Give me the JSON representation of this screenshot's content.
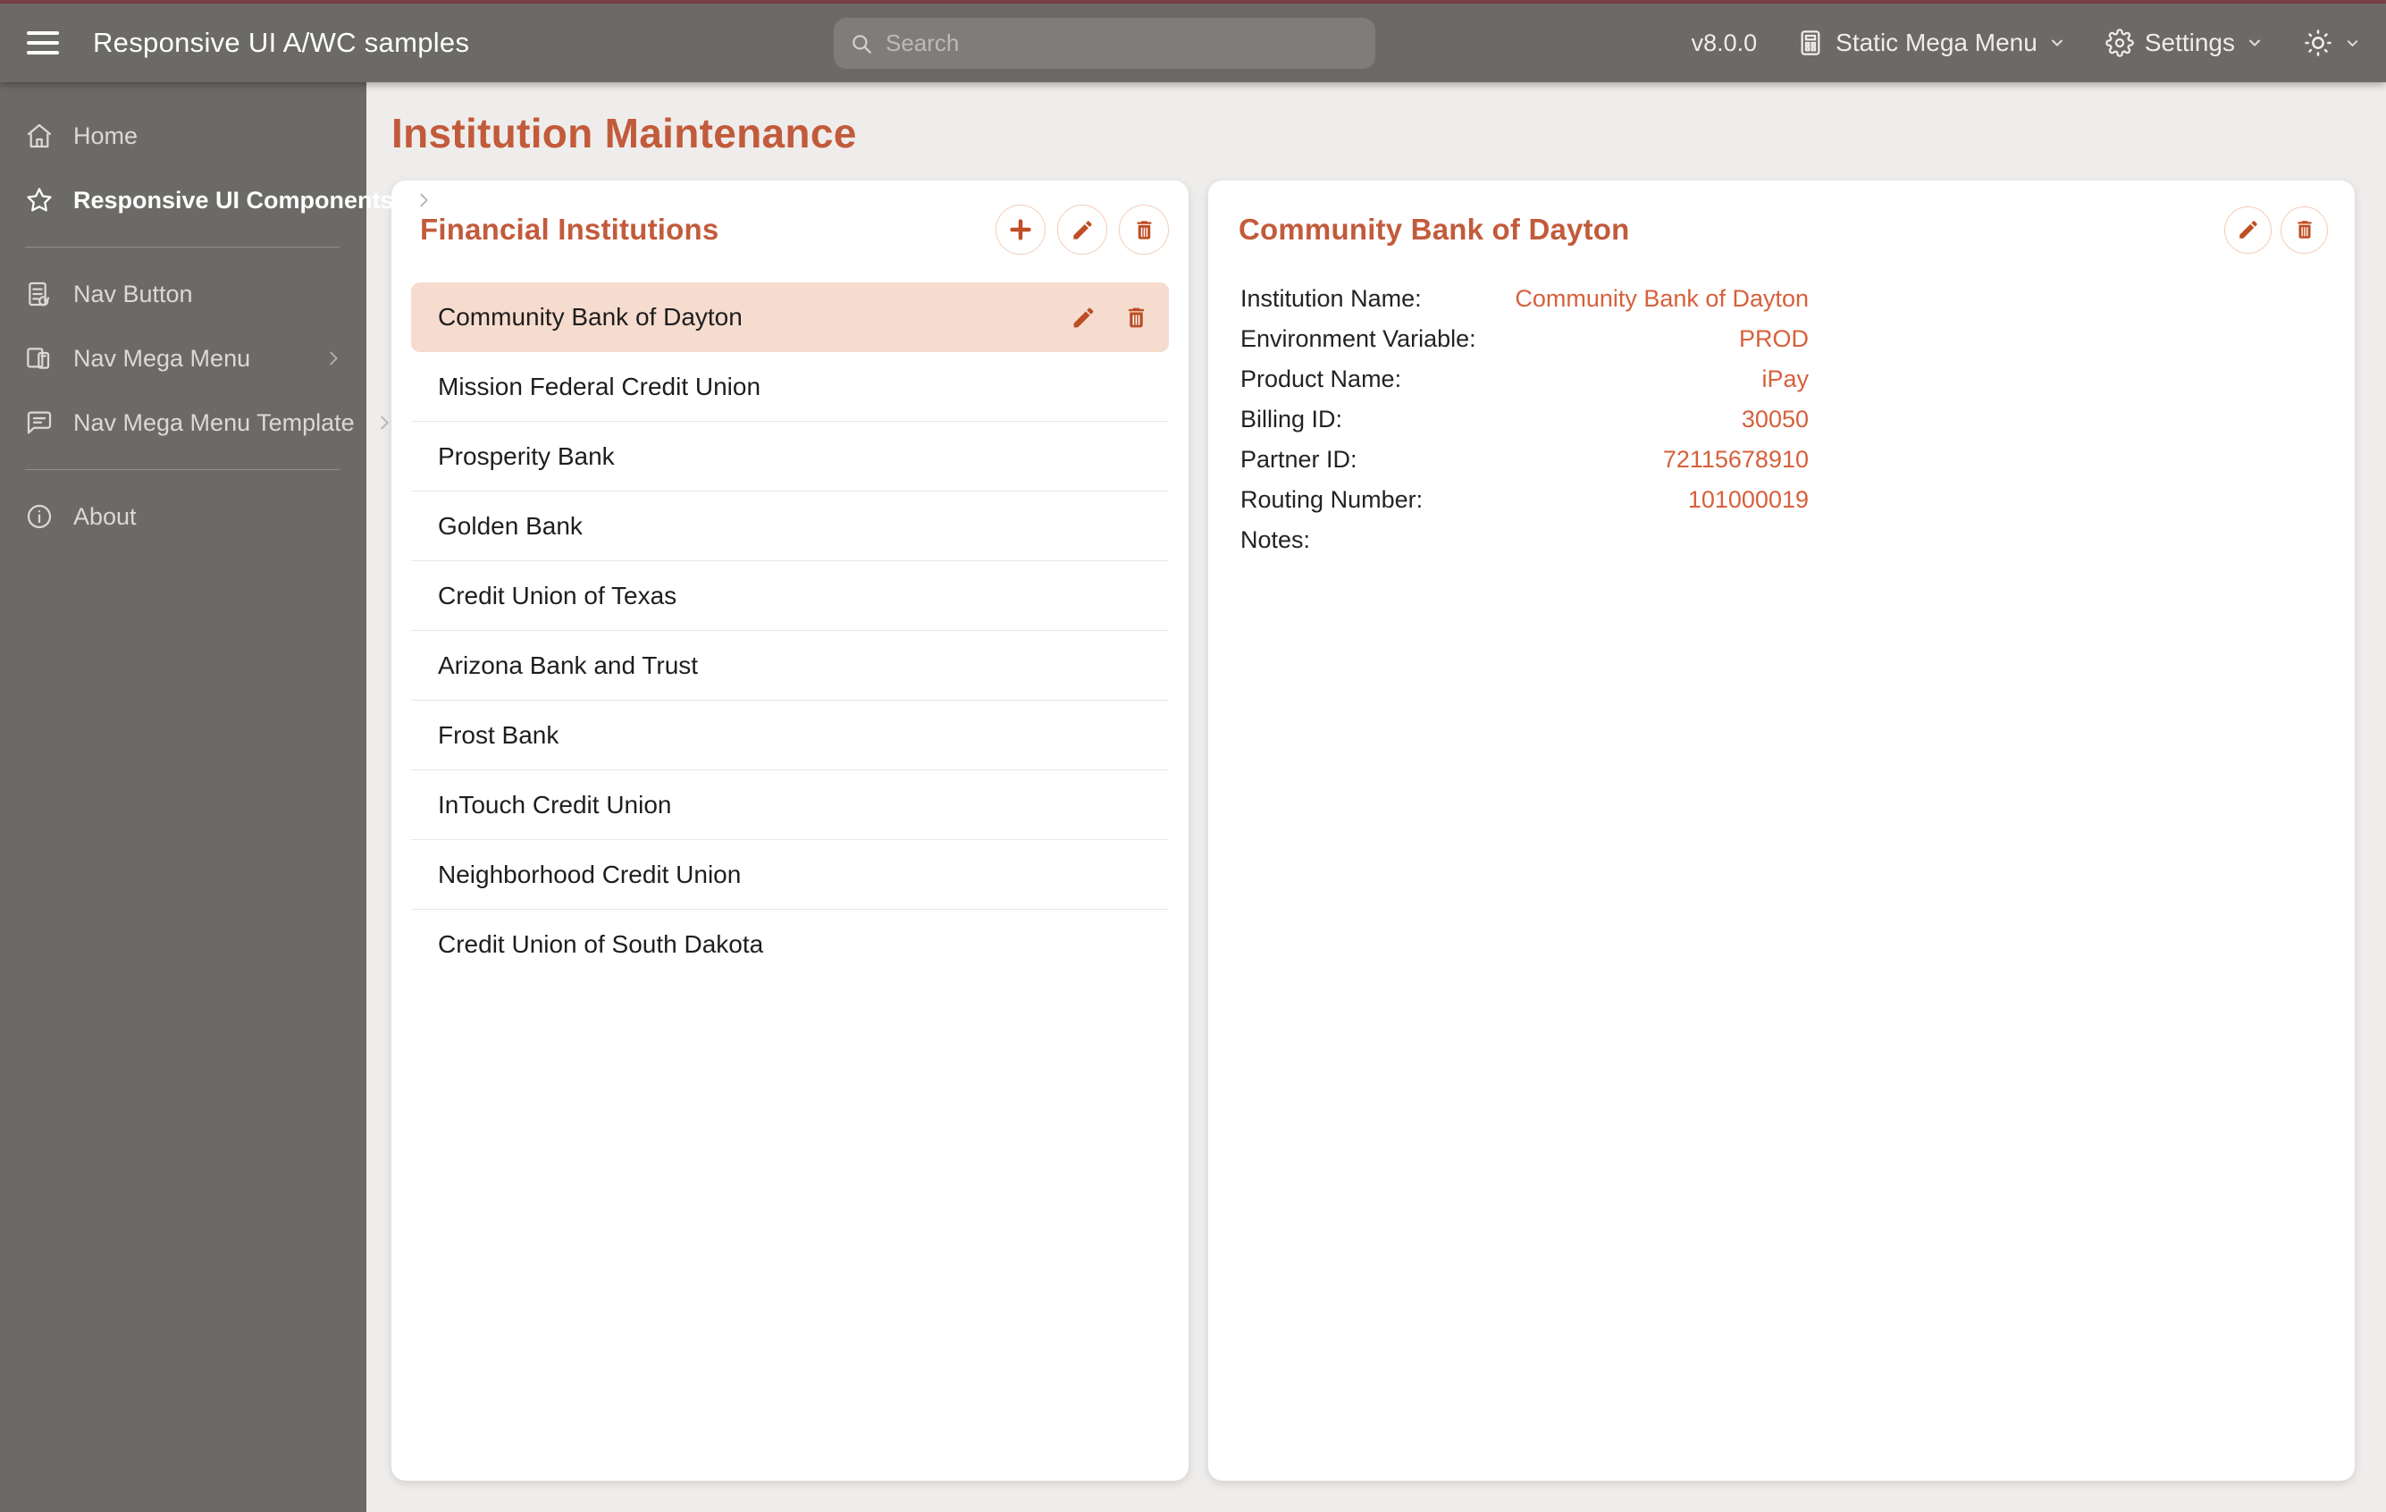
{
  "topbar": {
    "title": "Responsive UI A/WC samples",
    "search_placeholder": "Search",
    "version": "v8.0.0",
    "mega_menu_label": "Static Mega Menu",
    "settings_label": "Settings"
  },
  "sidebar": {
    "items": [
      {
        "label": "Home",
        "icon": "home-icon",
        "bold": false,
        "chevron": false,
        "divider_after": false
      },
      {
        "label": "Responsive UI Components",
        "icon": "star-icon",
        "bold": true,
        "chevron": true,
        "divider_after": true
      },
      {
        "label": "Nav Button",
        "icon": "nav-button-icon",
        "bold": false,
        "chevron": false,
        "divider_after": false
      },
      {
        "label": "Nav Mega Menu",
        "icon": "mega-menu-screens-icon",
        "bold": false,
        "chevron": true,
        "divider_after": false
      },
      {
        "label": "Nav Mega Menu Template",
        "icon": "template-bubble-icon",
        "bold": false,
        "chevron": true,
        "divider_after": true
      },
      {
        "label": "About",
        "icon": "info-icon",
        "bold": false,
        "chevron": false,
        "divider_after": false
      }
    ]
  },
  "page": {
    "title": "Institution Maintenance"
  },
  "list_card": {
    "title": "Financial Institutions",
    "selected_index": 0,
    "items": [
      "Community Bank of Dayton",
      "Mission Federal Credit Union",
      "Prosperity Bank",
      "Golden Bank",
      "Credit Union of Texas",
      "Arizona Bank and Trust",
      "Frost Bank",
      "InTouch Credit Union",
      "Neighborhood Credit Union",
      "Credit Union of South Dakota"
    ]
  },
  "detail_card": {
    "title": "Community Bank of Dayton",
    "fields": [
      {
        "label": "Institution Name:",
        "value": "Community Bank of Dayton"
      },
      {
        "label": "Environment Variable:",
        "value": "PROD"
      },
      {
        "label": "Product Name:",
        "value": "iPay"
      },
      {
        "label": "Billing ID:",
        "value": "30050"
      },
      {
        "label": "Partner ID:",
        "value": "72115678910"
      },
      {
        "label": "Routing Number:",
        "value": "101000019"
      },
      {
        "label": "Notes:",
        "value": ""
      }
    ]
  },
  "colors": {
    "top_strip": "#7b4147",
    "bar_gray": "#6c6a67",
    "accent_heading": "#c25b3b",
    "accent_value": "#d7603b",
    "accent_icon": "#be4e24",
    "selected_row_bg": "#f6dcce",
    "content_bg": "#efedeb"
  }
}
